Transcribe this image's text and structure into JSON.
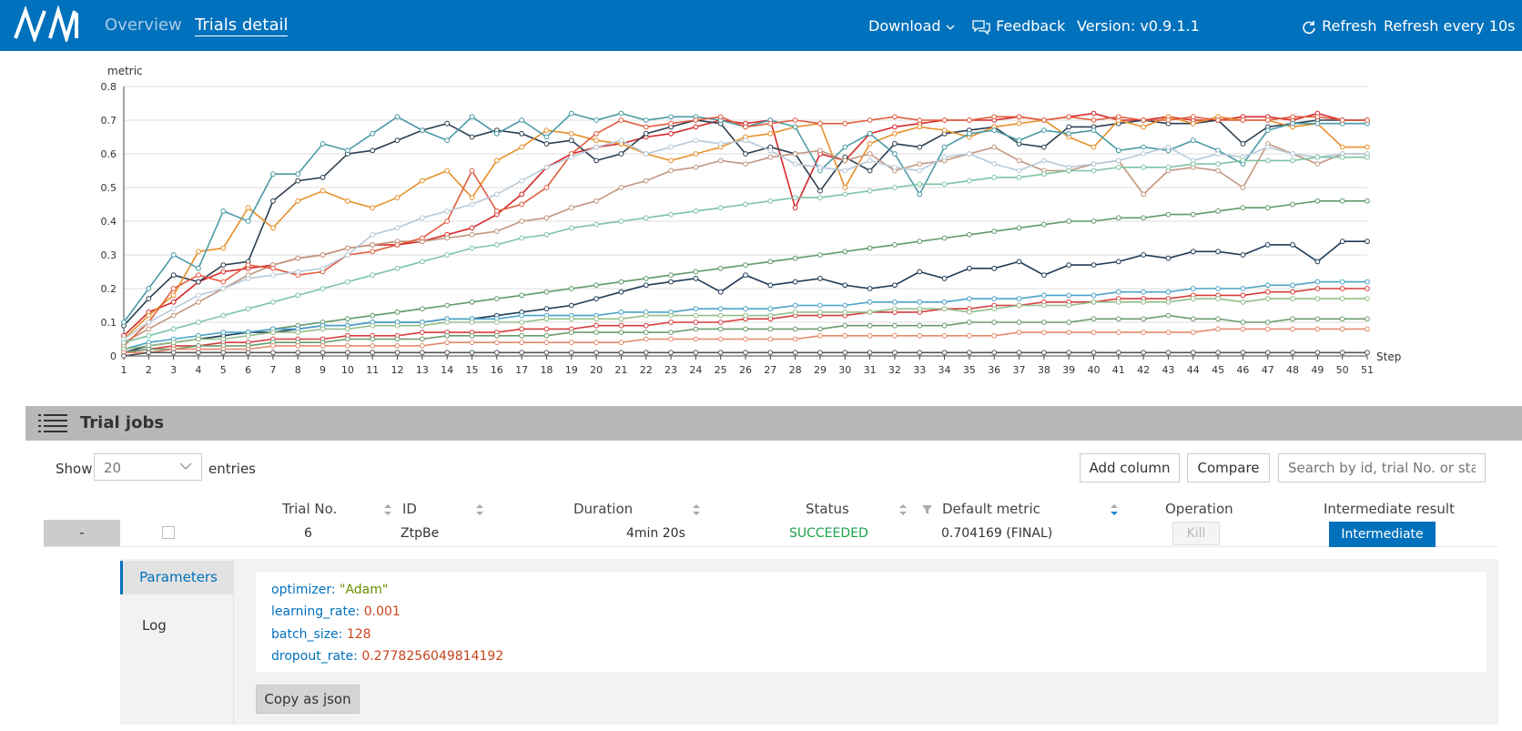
{
  "app": {
    "nav": {
      "overview": "Overview",
      "trials_detail": "Trials detail"
    },
    "toolbar": {
      "download": "Download",
      "feedback": "Feedback",
      "version": "Version: v0.9.1.1",
      "refresh": "Refresh",
      "refresh_interval": "Refresh every 10s"
    },
    "brand_color": "#0071bc"
  },
  "chart_data": {
    "type": "line",
    "ylabel": "metric",
    "xlabel": "Step",
    "x": [
      1,
      2,
      3,
      4,
      5,
      6,
      7,
      8,
      9,
      10,
      11,
      12,
      13,
      14,
      15,
      16,
      17,
      18,
      19,
      20,
      21,
      22,
      23,
      24,
      25,
      26,
      27,
      28,
      29,
      30,
      31,
      32,
      33,
      34,
      35,
      36,
      37,
      38,
      39,
      40,
      41,
      42,
      43,
      44,
      45,
      46,
      47,
      48,
      49,
      50,
      51
    ],
    "ylim": [
      0,
      0.8
    ],
    "yticks": [
      "0",
      "0.1",
      "0.2",
      "0.3",
      "0.4",
      "0.5",
      "0.6",
      "0.7",
      "0.8"
    ],
    "grid": "horizontal",
    "series": [
      {
        "color": "#d62728",
        "values": [
          0.06,
          0.13,
          0.16,
          0.22,
          0.25,
          0.26,
          0.27,
          0.29,
          0.3,
          0.32,
          0.33,
          0.33,
          0.34,
          0.36,
          0.38,
          0.42,
          0.48,
          0.56,
          0.6,
          0.62,
          0.63,
          0.65,
          0.66,
          0.68,
          0.7,
          0.69,
          0.7,
          0.44,
          0.6,
          0.58,
          0.66,
          0.68,
          0.69,
          0.7,
          0.7,
          0.7,
          0.71,
          0.7,
          0.71,
          0.72,
          0.7,
          0.7,
          0.71,
          0.7,
          0.7,
          0.71,
          0.71,
          0.7,
          0.72,
          0.7,
          0.7
        ]
      },
      {
        "color": "#2c3e50",
        "values": [
          0.09,
          0.17,
          0.24,
          0.22,
          0.27,
          0.28,
          0.46,
          0.52,
          0.53,
          0.6,
          0.61,
          0.64,
          0.67,
          0.69,
          0.65,
          0.67,
          0.66,
          0.63,
          0.64,
          0.58,
          0.6,
          0.66,
          0.68,
          0.7,
          0.69,
          0.6,
          0.62,
          0.6,
          0.49,
          0.59,
          0.55,
          0.63,
          0.62,
          0.66,
          0.67,
          0.68,
          0.63,
          0.62,
          0.68,
          0.68,
          0.69,
          0.7,
          0.69,
          0.69,
          0.7,
          0.63,
          0.68,
          0.69,
          0.7,
          0.7,
          0.7
        ]
      },
      {
        "color": "#e6902b",
        "values": [
          0.05,
          0.12,
          0.18,
          0.31,
          0.32,
          0.44,
          0.38,
          0.46,
          0.49,
          0.46,
          0.44,
          0.47,
          0.52,
          0.55,
          0.47,
          0.58,
          0.62,
          0.67,
          0.66,
          0.64,
          0.63,
          0.6,
          0.58,
          0.6,
          0.62,
          0.65,
          0.66,
          0.68,
          0.69,
          0.5,
          0.63,
          0.66,
          0.68,
          0.67,
          0.65,
          0.68,
          0.69,
          0.7,
          0.65,
          0.62,
          0.7,
          0.68,
          0.71,
          0.69,
          0.71,
          0.7,
          0.7,
          0.68,
          0.69,
          0.62,
          0.62
        ]
      },
      {
        "color": "#4a9aa5",
        "values": [
          0.1,
          0.2,
          0.3,
          0.26,
          0.43,
          0.4,
          0.54,
          0.54,
          0.63,
          0.61,
          0.66,
          0.71,
          0.67,
          0.64,
          0.71,
          0.66,
          0.7,
          0.65,
          0.72,
          0.7,
          0.72,
          0.7,
          0.71,
          0.71,
          0.7,
          0.68,
          0.7,
          0.68,
          0.55,
          0.62,
          0.66,
          0.6,
          0.48,
          0.62,
          0.66,
          0.67,
          0.64,
          0.67,
          0.66,
          0.67,
          0.61,
          0.62,
          0.61,
          0.64,
          0.61,
          0.57,
          0.67,
          0.69,
          0.69,
          0.69,
          0.69
        ]
      },
      {
        "color": "#c0967f",
        "values": [
          0.04,
          0.08,
          0.12,
          0.16,
          0.2,
          0.24,
          0.27,
          0.29,
          0.3,
          0.32,
          0.33,
          0.34,
          0.34,
          0.35,
          0.36,
          0.37,
          0.4,
          0.41,
          0.44,
          0.46,
          0.5,
          0.52,
          0.55,
          0.56,
          0.58,
          0.57,
          0.59,
          0.6,
          0.61,
          0.58,
          0.6,
          0.55,
          0.57,
          0.58,
          0.6,
          0.62,
          0.58,
          0.55,
          0.55,
          0.57,
          0.58,
          0.48,
          0.55,
          0.56,
          0.55,
          0.5,
          0.63,
          0.6,
          0.57,
          0.6,
          0.6
        ]
      },
      {
        "color": "#e05c3e",
        "values": [
          0.03,
          0.1,
          0.2,
          0.24,
          0.22,
          0.27,
          0.26,
          0.24,
          0.25,
          0.3,
          0.31,
          0.33,
          0.35,
          0.4,
          0.55,
          0.43,
          0.45,
          0.5,
          0.6,
          0.66,
          0.7,
          0.68,
          0.69,
          0.7,
          0.71,
          0.68,
          0.69,
          0.7,
          0.69,
          0.69,
          0.7,
          0.71,
          0.7,
          0.7,
          0.7,
          0.71,
          0.71,
          0.7,
          0.71,
          0.7,
          0.71,
          0.7,
          0.7,
          0.71,
          0.7,
          0.7,
          0.7,
          0.71,
          0.71,
          0.7,
          0.7
        ]
      },
      {
        "color": "#b7c9d8",
        "values": [
          0.05,
          0.1,
          0.14,
          0.18,
          0.2,
          0.23,
          0.24,
          0.25,
          0.26,
          0.3,
          0.36,
          0.38,
          0.41,
          0.43,
          0.45,
          0.48,
          0.52,
          0.56,
          0.59,
          0.62,
          0.64,
          0.6,
          0.62,
          0.64,
          0.63,
          0.64,
          0.61,
          0.57,
          0.56,
          0.55,
          0.58,
          0.56,
          0.55,
          0.59,
          0.6,
          0.57,
          0.55,
          0.58,
          0.56,
          0.57,
          0.58,
          0.6,
          0.62,
          0.58,
          0.6,
          0.59,
          0.62,
          0.6,
          0.59,
          0.6,
          0.6
        ]
      },
      {
        "color": "#7dc4a5",
        "values": [
          0.04,
          0.06,
          0.08,
          0.1,
          0.12,
          0.14,
          0.16,
          0.18,
          0.2,
          0.22,
          0.24,
          0.26,
          0.28,
          0.3,
          0.32,
          0.33,
          0.35,
          0.36,
          0.38,
          0.39,
          0.4,
          0.41,
          0.42,
          0.43,
          0.44,
          0.45,
          0.46,
          0.47,
          0.47,
          0.48,
          0.49,
          0.5,
          0.51,
          0.51,
          0.52,
          0.53,
          0.53,
          0.54,
          0.55,
          0.55,
          0.56,
          0.56,
          0.56,
          0.57,
          0.57,
          0.58,
          0.58,
          0.58,
          0.59,
          0.59,
          0.59
        ]
      },
      {
        "color": "#5f9a6a",
        "values": [
          0.02,
          0.03,
          0.04,
          0.05,
          0.06,
          0.07,
          0.08,
          0.09,
          0.1,
          0.11,
          0.12,
          0.13,
          0.14,
          0.15,
          0.16,
          0.17,
          0.18,
          0.19,
          0.2,
          0.21,
          0.22,
          0.23,
          0.24,
          0.25,
          0.26,
          0.27,
          0.28,
          0.29,
          0.3,
          0.31,
          0.32,
          0.33,
          0.34,
          0.35,
          0.36,
          0.37,
          0.38,
          0.39,
          0.4,
          0.4,
          0.41,
          0.41,
          0.42,
          0.42,
          0.43,
          0.44,
          0.44,
          0.45,
          0.46,
          0.46,
          0.46
        ]
      },
      {
        "color": "#1f3b57",
        "values": [
          0.01,
          0.03,
          0.04,
          0.05,
          0.06,
          0.07,
          0.07,
          0.08,
          0.09,
          0.09,
          0.1,
          0.1,
          0.1,
          0.11,
          0.11,
          0.12,
          0.13,
          0.14,
          0.15,
          0.17,
          0.19,
          0.21,
          0.22,
          0.23,
          0.19,
          0.24,
          0.21,
          0.22,
          0.23,
          0.21,
          0.2,
          0.21,
          0.25,
          0.23,
          0.26,
          0.26,
          0.28,
          0.24,
          0.27,
          0.27,
          0.28,
          0.3,
          0.29,
          0.31,
          0.31,
          0.3,
          0.33,
          0.33,
          0.28,
          0.34,
          0.34
        ]
      },
      {
        "color": "#4ba3c8",
        "values": [
          0.02,
          0.04,
          0.05,
          0.06,
          0.07,
          0.07,
          0.08,
          0.08,
          0.09,
          0.09,
          0.1,
          0.1,
          0.1,
          0.11,
          0.11,
          0.11,
          0.12,
          0.12,
          0.12,
          0.12,
          0.13,
          0.13,
          0.13,
          0.14,
          0.14,
          0.14,
          0.14,
          0.15,
          0.15,
          0.15,
          0.16,
          0.16,
          0.16,
          0.16,
          0.17,
          0.17,
          0.17,
          0.18,
          0.18,
          0.18,
          0.19,
          0.19,
          0.19,
          0.2,
          0.2,
          0.2,
          0.21,
          0.21,
          0.22,
          0.22,
          0.22
        ]
      },
      {
        "color": "#d63c3c",
        "values": [
          0.01,
          0.02,
          0.03,
          0.03,
          0.04,
          0.04,
          0.05,
          0.05,
          0.05,
          0.06,
          0.06,
          0.06,
          0.07,
          0.07,
          0.07,
          0.07,
          0.08,
          0.08,
          0.08,
          0.09,
          0.09,
          0.09,
          0.1,
          0.1,
          0.1,
          0.11,
          0.11,
          0.12,
          0.12,
          0.12,
          0.13,
          0.13,
          0.13,
          0.14,
          0.14,
          0.15,
          0.15,
          0.16,
          0.16,
          0.16,
          0.17,
          0.17,
          0.17,
          0.18,
          0.18,
          0.18,
          0.19,
          0.19,
          0.2,
          0.2,
          0.2
        ]
      },
      {
        "color": "#94bf8a",
        "values": [
          0.02,
          0.03,
          0.04,
          0.05,
          0.05,
          0.06,
          0.07,
          0.07,
          0.08,
          0.08,
          0.09,
          0.09,
          0.09,
          0.1,
          0.1,
          0.1,
          0.1,
          0.11,
          0.11,
          0.11,
          0.11,
          0.12,
          0.12,
          0.12,
          0.12,
          0.12,
          0.12,
          0.13,
          0.13,
          0.13,
          0.13,
          0.14,
          0.14,
          0.14,
          0.13,
          0.14,
          0.15,
          0.15,
          0.15,
          0.16,
          0.16,
          0.16,
          0.16,
          0.17,
          0.17,
          0.16,
          0.17,
          0.17,
          0.17,
          0.17,
          0.17
        ]
      },
      {
        "color": "#6b9b6d",
        "values": [
          0.01,
          0.02,
          0.02,
          0.03,
          0.03,
          0.03,
          0.04,
          0.04,
          0.04,
          0.05,
          0.05,
          0.05,
          0.05,
          0.06,
          0.06,
          0.06,
          0.06,
          0.06,
          0.07,
          0.07,
          0.07,
          0.07,
          0.07,
          0.08,
          0.08,
          0.08,
          0.08,
          0.08,
          0.08,
          0.09,
          0.09,
          0.09,
          0.09,
          0.09,
          0.1,
          0.1,
          0.1,
          0.1,
          0.1,
          0.11,
          0.11,
          0.11,
          0.12,
          0.11,
          0.11,
          0.1,
          0.1,
          0.11,
          0.11,
          0.11,
          0.11
        ]
      },
      {
        "color": "#e58a6a",
        "values": [
          0.01,
          0.01,
          0.02,
          0.02,
          0.02,
          0.02,
          0.03,
          0.03,
          0.03,
          0.03,
          0.03,
          0.03,
          0.03,
          0.04,
          0.04,
          0.04,
          0.04,
          0.04,
          0.04,
          0.04,
          0.04,
          0.05,
          0.05,
          0.05,
          0.05,
          0.05,
          0.05,
          0.05,
          0.06,
          0.06,
          0.06,
          0.06,
          0.06,
          0.06,
          0.06,
          0.06,
          0.07,
          0.07,
          0.07,
          0.07,
          0.07,
          0.07,
          0.07,
          0.07,
          0.08,
          0.08,
          0.08,
          0.08,
          0.08,
          0.08,
          0.08
        ]
      },
      {
        "color": "#555555",
        "values": [
          0.0,
          0.01,
          0.01,
          0.01,
          0.01,
          0.01,
          0.01,
          0.01,
          0.01,
          0.01,
          0.01,
          0.01,
          0.01,
          0.01,
          0.01,
          0.01,
          0.01,
          0.01,
          0.01,
          0.01,
          0.01,
          0.01,
          0.01,
          0.01,
          0.01,
          0.01,
          0.01,
          0.01,
          0.01,
          0.01,
          0.01,
          0.01,
          0.01,
          0.01,
          0.01,
          0.01,
          0.01,
          0.01,
          0.01,
          0.01,
          0.01,
          0.01,
          0.01,
          0.01,
          0.01,
          0.01,
          0.01,
          0.01,
          0.01,
          0.01,
          0.01
        ]
      }
    ]
  },
  "trial_jobs": {
    "title": "Trial jobs",
    "show_label": "Show",
    "entries_value": "20",
    "entries_label": "entries",
    "add_column": "Add column",
    "compare": "Compare",
    "search_placeholder": "Search by id, trial No. or status",
    "columns": {
      "trial_no": "Trial No.",
      "id": "ID",
      "duration": "Duration",
      "status": "Status",
      "default_metric": "Default metric",
      "operation": "Operation",
      "intermediate_result": "Intermediate result"
    },
    "row": {
      "expand": "-",
      "trial_no": "6",
      "id": "ZtpBe",
      "duration": "4min 20s",
      "status": "SUCCEEDED",
      "status_color": "#1aa34a",
      "default_metric": "0.704169 (FINAL)",
      "kill": "Kill",
      "intermediate": "Intermediate"
    },
    "detail": {
      "tabs": {
        "parameters": "Parameters",
        "log": "Log"
      },
      "params": [
        {
          "key": "optimizer:",
          "value": "\"Adam\""
        },
        {
          "key": "learning_rate:",
          "value": "0.001"
        },
        {
          "key": "batch_size:",
          "value": "128"
        },
        {
          "key": "dropout_rate:",
          "value": "0.2778256049814192"
        }
      ],
      "copy_json": "Copy as json"
    }
  }
}
